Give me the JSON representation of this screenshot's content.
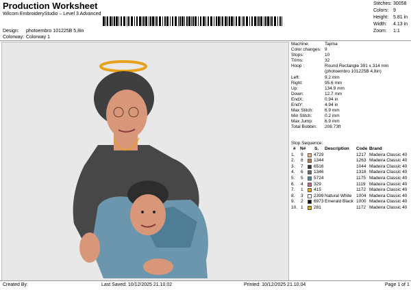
{
  "header": {
    "title": "Production Worksheet",
    "subtitle": "Wilcom EmbroideryStudio – Level 3 Advanced",
    "design_label": "Design:",
    "design_value": "photoembro 101225B 5,8in",
    "colorway_label": "Colorway:",
    "colorway_value": "Colorway 1"
  },
  "stats": [
    {
      "label": "Stitches:",
      "value": "30058"
    },
    {
      "label": "Colors:",
      "value": "9"
    },
    {
      "label": "Height:",
      "value": "5.81 in"
    },
    {
      "label": "Width:",
      "value": "4.13 in"
    },
    {
      "label": "Zoom:",
      "value": "1:1"
    }
  ],
  "info": [
    {
      "label": "Machine:",
      "value": "Tajima"
    },
    {
      "label": "Color changes:",
      "value": "9"
    },
    {
      "label": "Stops:",
      "value": "10"
    },
    {
      "label": "Trims:",
      "value": "32"
    },
    {
      "label": "Hoop :",
      "value": "Round Rectangle 391 x 314 mm"
    },
    {
      "label": "",
      "value": "(photoembro 101225B 4,8in)"
    },
    {
      "label": "Left:",
      "value": "9.2 mm"
    },
    {
      "label": "Right:",
      "value": "95.6 mm"
    },
    {
      "label": "Up:",
      "value": "134.9 mm"
    },
    {
      "label": "Down:",
      "value": "12.7 mm"
    },
    {
      "label": "EndX:",
      "value": "0.94 in"
    },
    {
      "label": "EndY:",
      "value": "4.94 in"
    },
    {
      "label": "Max Stitch:",
      "value": "6.9 mm"
    },
    {
      "label": "Min Stitch:",
      "value": "0.2 mm"
    },
    {
      "label": "Max Jump:",
      "value": "6.9 mm"
    },
    {
      "label": "Total Bobbin:",
      "value": "208.73ft"
    }
  ],
  "stop_sequence_label": "Stop Sequence:",
  "table_headers": {
    "stop": "#",
    "n": "N#",
    "s": "S.",
    "desc": "Description",
    "code": "Code",
    "brand": "Brand"
  },
  "stops": [
    {
      "stop": "1.",
      "n": "9",
      "color": "#e9b38f",
      "s": "4729",
      "desc": "",
      "code": "1217",
      "brand": "Madeira Classic 40"
    },
    {
      "stop": "2.",
      "n": "8",
      "color": "#c8765a",
      "s": "1344",
      "desc": "",
      "code": "1263",
      "brand": "Madeira Classic 40"
    },
    {
      "stop": "3.",
      "n": "7",
      "color": "#3a3a3a",
      "s": "6516",
      "desc": "",
      "code": "1044",
      "brand": "Madeira Classic 40"
    },
    {
      "stop": "4.",
      "n": "6",
      "color": "#6b6b6b",
      "s": "1346",
      "desc": "",
      "code": "1318",
      "brand": "Madeira Classic 40"
    },
    {
      "stop": "5.",
      "n": "5",
      "color": "#4f8caa",
      "s": "5724",
      "desc": "",
      "code": "1175",
      "brand": "Madeira Classic 40"
    },
    {
      "stop": "6.",
      "n": "4",
      "color": "#c86a86",
      "s": "329",
      "desc": "",
      "code": "1119",
      "brand": "Madeira Classic 40"
    },
    {
      "stop": "7.",
      "n": "1",
      "color": "#e8a21a",
      "s": "415",
      "desc": "",
      "code": "1172",
      "brand": "Madeira Classic 40"
    },
    {
      "stop": "8.",
      "n": "3",
      "color": "#ffffff",
      "s": "2399",
      "desc": "Natural White",
      "code": "1004",
      "brand": "Madeira Classic 40"
    },
    {
      "stop": "9.",
      "n": "2",
      "color": "#111111",
      "s": "6973",
      "desc": "Emerald Black",
      "code": "1000",
      "brand": "Madeira Classic 40"
    },
    {
      "stop": "10.",
      "n": "1",
      "color": "#e8a21a",
      "s": "281",
      "desc": "",
      "code": "1172",
      "brand": "Madeira Classic 40"
    }
  ],
  "footer": {
    "created": "Created By:",
    "saved": "Last Saved: 10/12/2025 21.10.02",
    "printed": "Printed: 10/12/2025 21.10.04",
    "page": "Page 1 of 1"
  }
}
